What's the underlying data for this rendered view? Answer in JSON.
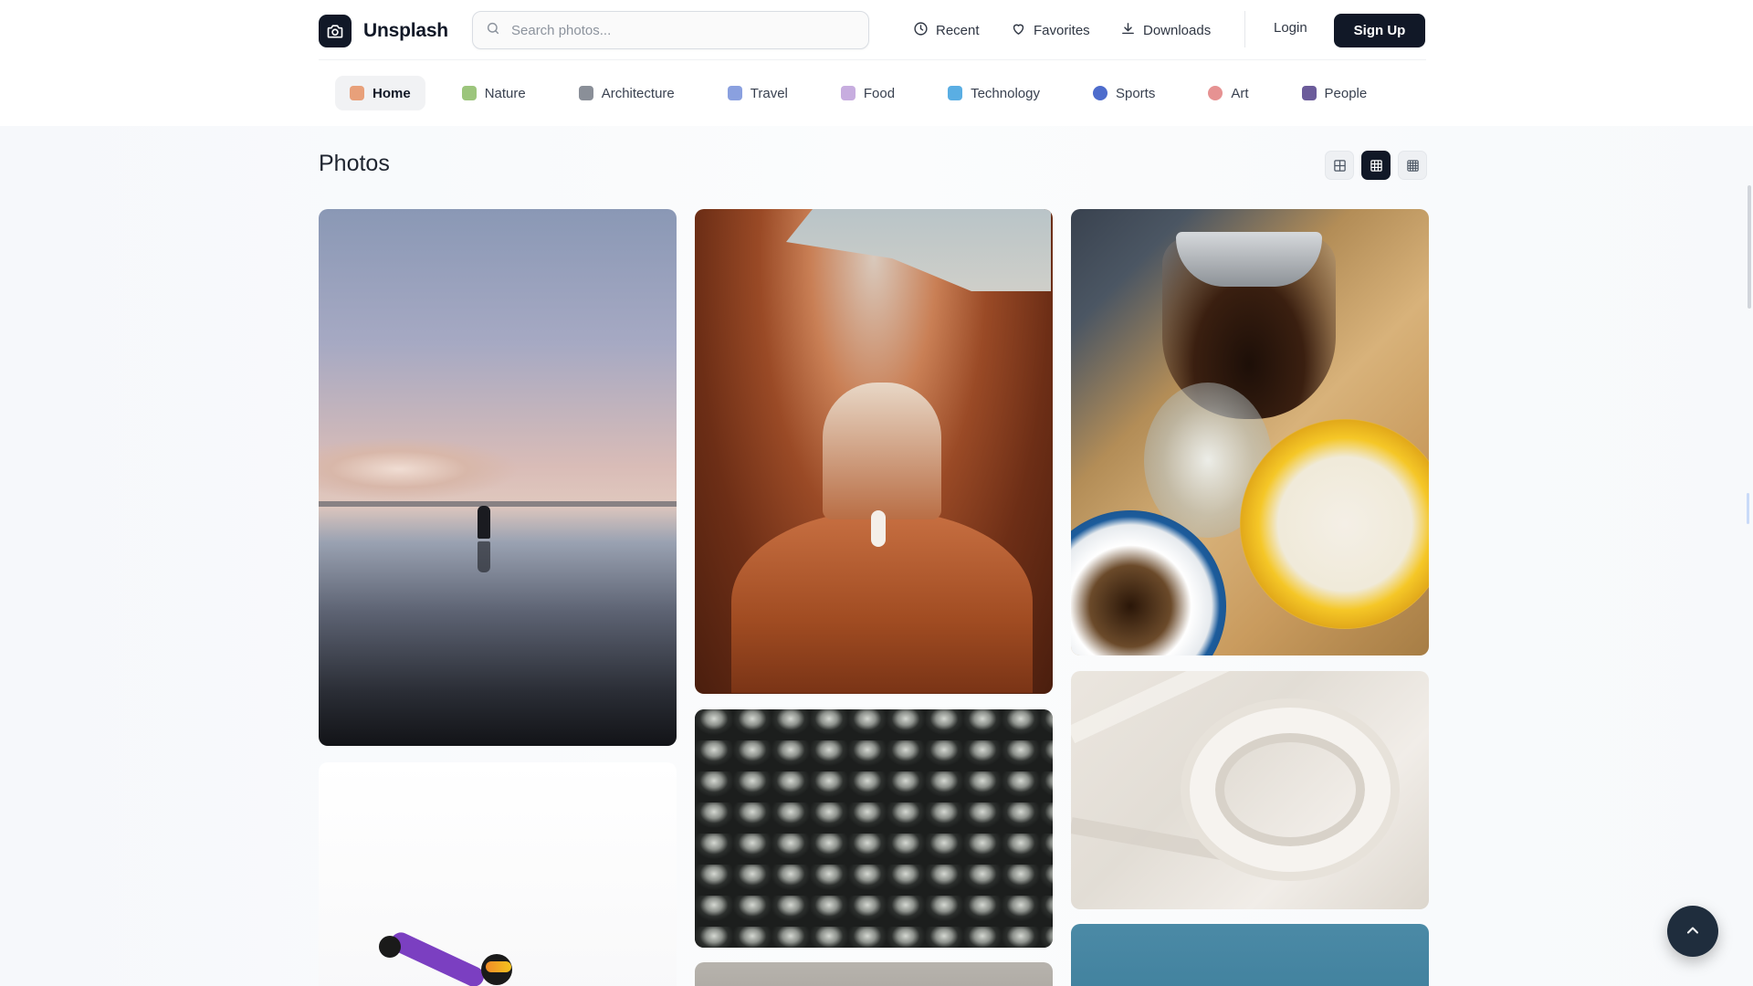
{
  "app": {
    "name": "Unsplash"
  },
  "search": {
    "placeholder": "Search photos..."
  },
  "topnav": {
    "recent": "Recent",
    "favorites": "Favorites",
    "downloads": "Downloads",
    "login": "Login",
    "signup": "Sign Up"
  },
  "categories": [
    {
      "label": "Home",
      "icon": "home-icon",
      "color": "#e07a5f"
    },
    {
      "label": "Nature",
      "icon": "leaf-icon",
      "color": "#7fb069"
    },
    {
      "label": "Architecture",
      "icon": "building-icon",
      "color": "#6b7280"
    },
    {
      "label": "Travel",
      "icon": "airplane-icon",
      "color": "#7c8fd1"
    },
    {
      "label": "Food",
      "icon": "food-icon",
      "color": "#b79ad9"
    },
    {
      "label": "Technology",
      "icon": "computer-icon",
      "color": "#4aa3df"
    },
    {
      "label": "Sports",
      "icon": "ball-icon",
      "color": "#3b5cc4"
    },
    {
      "label": "Art",
      "icon": "palette-icon",
      "color": "#e07a7a"
    },
    {
      "label": "People",
      "icon": "people-icon",
      "color": "#5b4b8a"
    }
  ],
  "section": {
    "title": "Photos"
  },
  "colors": {
    "brand_dark": "#111827",
    "background": "#f7f8fa",
    "accent_button": "#1f2d3d"
  }
}
